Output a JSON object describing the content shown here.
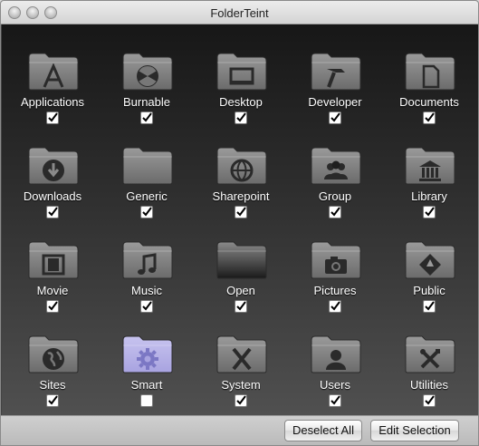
{
  "window": {
    "title": "FolderTeint"
  },
  "folders": [
    {
      "label": "Applications",
      "icon": "applications-icon",
      "checked": true
    },
    {
      "label": "Burnable",
      "icon": "burnable-icon",
      "checked": true
    },
    {
      "label": "Desktop",
      "icon": "desktop-icon",
      "checked": true
    },
    {
      "label": "Developer",
      "icon": "developer-hammer-icon",
      "checked": true
    },
    {
      "label": "Documents",
      "icon": "document-icon",
      "checked": true
    },
    {
      "label": "Downloads",
      "icon": "download-icon",
      "checked": true
    },
    {
      "label": "Generic",
      "icon": "generic-folder-icon",
      "checked": true
    },
    {
      "label": "Sharepoint",
      "icon": "sharepoint-globe-icon",
      "checked": true
    },
    {
      "label": "Group",
      "icon": "group-icon",
      "checked": true
    },
    {
      "label": "Library",
      "icon": "library-icon",
      "checked": true
    },
    {
      "label": "Movie",
      "icon": "film-icon",
      "checked": true
    },
    {
      "label": "Music",
      "icon": "music-note-icon",
      "checked": true
    },
    {
      "label": "Open",
      "icon": "open-folder-icon",
      "checked": true
    },
    {
      "label": "Pictures",
      "icon": "camera-icon",
      "checked": true
    },
    {
      "label": "Public",
      "icon": "public-icon",
      "checked": true
    },
    {
      "label": "Sites",
      "icon": "globe-icon",
      "checked": true
    },
    {
      "label": "Smart",
      "icon": "gear-icon",
      "checked": false
    },
    {
      "label": "System",
      "icon": "system-x-icon",
      "checked": true
    },
    {
      "label": "Users",
      "icon": "user-icon",
      "checked": true
    },
    {
      "label": "Utilities",
      "icon": "utilities-tools-icon",
      "checked": true
    }
  ],
  "buttons": {
    "deselect_all": "Deselect All",
    "edit_selection": "Edit Selection"
  },
  "colors": {
    "folder_dark": "#6b6b6b",
    "folder_light": "#9a9a9a",
    "smart_folder": "#a8a3e0"
  }
}
